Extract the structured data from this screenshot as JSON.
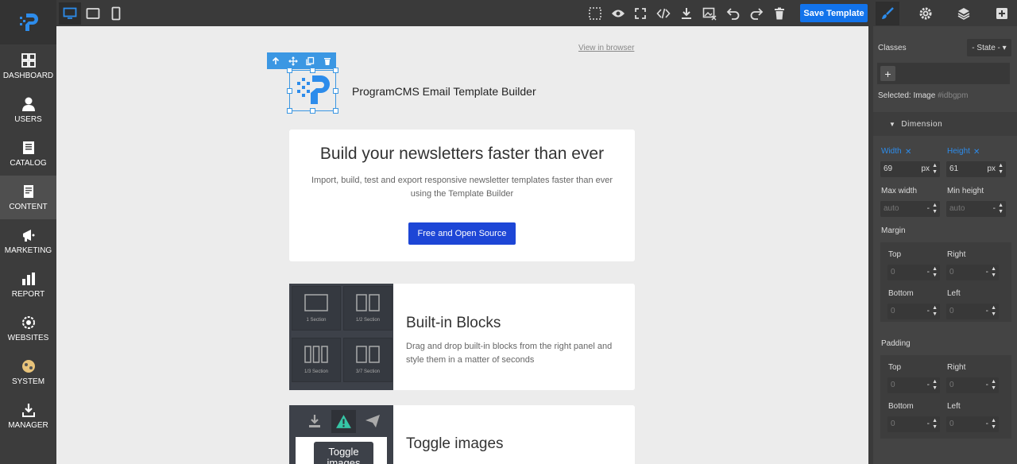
{
  "sidebar": {
    "items": [
      {
        "label": "DASHBOARD"
      },
      {
        "label": "USERS"
      },
      {
        "label": "CATALOG"
      },
      {
        "label": "CONTENT"
      },
      {
        "label": "MARKETING"
      },
      {
        "label": "REPORT"
      },
      {
        "label": "WEBSITES"
      },
      {
        "label": "SYSTEM"
      },
      {
        "label": "MANAGER"
      }
    ]
  },
  "toolbar": {
    "save_label": "Save Template"
  },
  "canvas": {
    "view_in_browser": "View in browser",
    "brand_text": "ProgramCMS Email Template Builder",
    "hero": {
      "title": "Build your newsletters faster than ever",
      "description": "Import, build, test and export responsive newsletter templates faster than ever using the Template Builder",
      "button": "Free and Open Source"
    },
    "blocks_feature": {
      "title": "Built-in Blocks",
      "description": "Drag and drop built-in blocks from the right panel and style them in a matter of seconds",
      "tiles": [
        "1 Section",
        "1/2 Section",
        "1/3 Section",
        "3/7 Section"
      ]
    },
    "toggle_feature": {
      "title": "Toggle images",
      "tooltip": "Toggle images"
    }
  },
  "panel": {
    "classes_label": "Classes",
    "state_label": "- State -",
    "selected_prefix": "Selected:",
    "selected_name": "Image",
    "selected_id": "#idbgpm",
    "dimension_label": "Dimension",
    "width_label": "Width",
    "width_value": "69",
    "width_unit": "px",
    "height_label": "Height",
    "height_value": "61",
    "height_unit": "px",
    "max_width_label": "Max width",
    "max_width_value": "auto",
    "min_height_label": "Min height",
    "min_height_value": "auto",
    "margin_label": "Margin",
    "padding_label": "Padding",
    "top_label": "Top",
    "right_label": "Right",
    "bottom_label": "Bottom",
    "left_label": "Left",
    "zero": "0",
    "dash": "-"
  },
  "colors": {
    "accent": "#1273eb",
    "selection": "#3b97e3",
    "hero_button": "#1d46d6"
  }
}
